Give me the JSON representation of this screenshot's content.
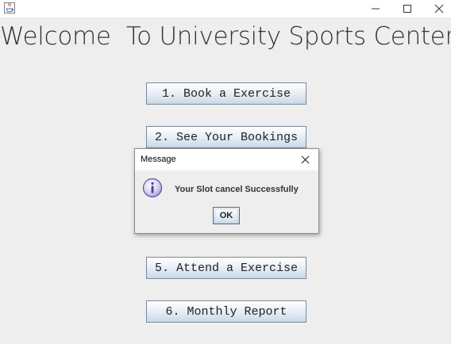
{
  "window": {
    "title": "",
    "icon": "java-icon"
  },
  "heading": "Welcome  To University Sports Center",
  "menu": {
    "buttons": [
      {
        "label": "1. Book a Exercise"
      },
      {
        "label": "2. See Your Bookings"
      },
      {
        "label": "5. Attend a Exercise"
      },
      {
        "label": "6. Monthly Report"
      }
    ]
  },
  "dialog": {
    "title": "Message",
    "icon": "info-icon",
    "message": "Your Slot cancel Successfully",
    "ok_label": "OK"
  },
  "colors": {
    "background": "#eeeeee",
    "button_gradient_top": "#ffffff",
    "button_gradient_bottom": "#c9d9e8",
    "button_border": "#7a8a99"
  }
}
